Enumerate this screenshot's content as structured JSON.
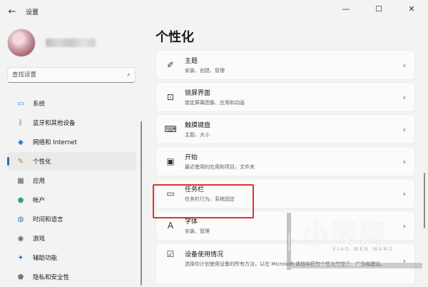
{
  "window": {
    "title": "设置",
    "back": "←",
    "minimize": "—",
    "maximize": "☐",
    "close": "✕"
  },
  "search": {
    "placeholder": "查找设置",
    "icon": "⌕"
  },
  "sidebar": {
    "items": [
      {
        "label": "系统",
        "icon": "▭",
        "icon_color": "#2d7fd3",
        "active": false
      },
      {
        "label": "蓝牙和其他设备",
        "icon": "ᛒ",
        "icon_color": "#1a73c7",
        "active": false
      },
      {
        "label": "网络和 Internet",
        "icon": "◆",
        "icon_color": "#2d7fd3",
        "active": false
      },
      {
        "label": "个性化",
        "icon": "✎",
        "icon_color": "#d47a20",
        "active": true
      },
      {
        "label": "应用",
        "icon": "▦",
        "icon_color": "#555555",
        "active": false
      },
      {
        "label": "帐户",
        "icon": "●",
        "icon_color": "#2fa36b",
        "active": false
      },
      {
        "label": "时间和语言",
        "icon": "◍",
        "icon_color": "#2d7fd3",
        "active": false
      },
      {
        "label": "游戏",
        "icon": "◉",
        "icon_color": "#666666",
        "active": false
      },
      {
        "label": "辅助功能",
        "icon": "✦",
        "icon_color": "#1a73c7",
        "active": false
      },
      {
        "label": "隐私和安全性",
        "icon": "⬟",
        "icon_color": "#777777",
        "active": false
      }
    ]
  },
  "main": {
    "title": "个性化",
    "cards": [
      {
        "title": "主题",
        "subtitle": "安装、创建、管理",
        "icon": "✐"
      },
      {
        "title": "锁屏界面",
        "subtitle": "锁定屏幕图像、应用和动画",
        "icon": "⊡"
      },
      {
        "title": "触摸键盘",
        "subtitle": "主题、大小",
        "icon": "⌨"
      },
      {
        "title": "开始",
        "subtitle": "最近使用的应用和项目、文件夹",
        "icon": "▣"
      },
      {
        "title": "任务栏",
        "subtitle": "任务栏行为、系统固定",
        "icon": "▭"
      },
      {
        "title": "字体",
        "subtitle": "安装、管理",
        "icon": "A"
      },
      {
        "title": "设备使用情况",
        "subtitle": "选择你计划使用设备的所有方法，以在 Microsoft 体验中获取个性化的提示、广告和建议。",
        "icon": "☑"
      }
    ],
    "chevron": "›"
  },
  "watermark": {
    "big": "小闻网",
    "small": "XIAO WEN WANG",
    "bar": "xiaowen.net  |  www.xiaowen.net",
    "vert": "xiaowen.net"
  },
  "colors": {
    "accent": "#1a73c7",
    "highlight": "#e0332a",
    "background": "#f3f3f3",
    "card": "#fbfbfb"
  }
}
